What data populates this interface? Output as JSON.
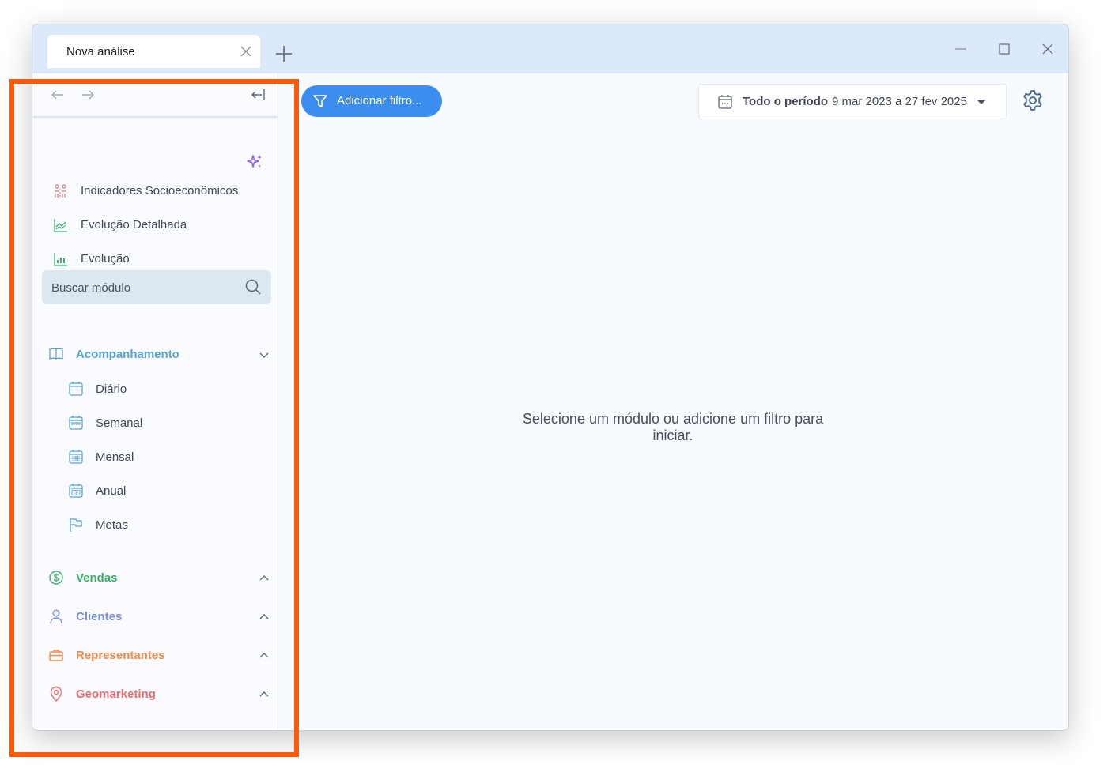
{
  "window": {
    "tab_title": "Nova análise",
    "tab_close_icon": "close-icon",
    "new_tab_icon": "plus-icon",
    "controls": [
      "minimize-icon",
      "maximize-icon",
      "close-icon"
    ]
  },
  "sidebar": {
    "nav": {
      "back_icon": "arrow-left-icon",
      "forward_icon": "arrow-right-icon",
      "collapse_icon": "collapse-sidebar-icon"
    },
    "ai_icon": "sparkles-icon",
    "quick_links": [
      {
        "label": "Indicadores Socioeconômicos",
        "icon": "people-chart-icon"
      },
      {
        "label": "Evolução Detalhada",
        "icon": "line-chart-icon"
      },
      {
        "label": "Evolução",
        "icon": "bar-chart-icon"
      }
    ],
    "search": {
      "placeholder": "Buscar módulo",
      "icon": "search-icon"
    },
    "sections": [
      {
        "label": "Acompanhamento",
        "icon": "book-icon",
        "expanded": true,
        "color": "#5aa4d6",
        "items": [
          {
            "label": "Diário",
            "icon": "calendar-day-icon"
          },
          {
            "label": "Semanal",
            "icon": "calendar-week-icon"
          },
          {
            "label": "Mensal",
            "icon": "calendar-month-icon"
          },
          {
            "label": "Anual",
            "icon": "calendar-year-icon"
          },
          {
            "label": "Metas",
            "icon": "flag-icon"
          }
        ]
      },
      {
        "label": "Vendas",
        "icon": "dollar-circle-icon",
        "expanded": false,
        "color": "#3fae6b"
      },
      {
        "label": "Clientes",
        "icon": "user-icon",
        "expanded": false,
        "color": "#7b8fd6"
      },
      {
        "label": "Representantes",
        "icon": "briefcase-icon",
        "expanded": false,
        "color": "#f08a4b"
      },
      {
        "label": "Geomarketing",
        "icon": "map-pin-icon",
        "expanded": false,
        "color": "#ef6f6f"
      }
    ]
  },
  "toolbar": {
    "add_filter_label": "Adicionar filtro...",
    "filter_icon": "filter-icon",
    "period_label": "Todo o período",
    "period_range": "9 mar 2023 a 27 fev 2025",
    "calendar_icon": "calendar-icon",
    "dropdown_icon": "caret-down-icon",
    "settings_icon": "gear-icon"
  },
  "main": {
    "empty_message": "Selecione um módulo ou adicione um filtro para iniciar."
  },
  "colors": {
    "accent": "#3b8df0",
    "highlight": "#ff5a0a"
  }
}
